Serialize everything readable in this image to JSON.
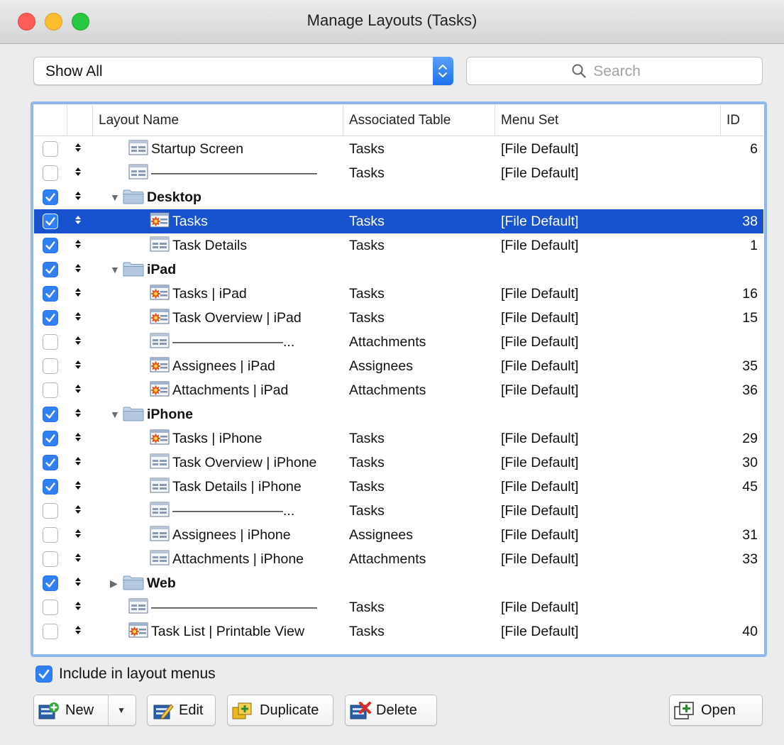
{
  "window": {
    "title": "Manage Layouts (Tasks)"
  },
  "filter": {
    "selected": "Show All"
  },
  "search": {
    "placeholder": "Search",
    "value": ""
  },
  "table": {
    "columns": {
      "name": "Layout Name",
      "table": "Associated Table",
      "menu": "Menu Set",
      "id": "ID"
    },
    "rows": [
      {
        "checked": false,
        "indent": 1,
        "kind": "layout",
        "icon": "list-layout-icon",
        "name": "Startup Screen",
        "table": "Tasks",
        "menu": "[File Default]",
        "id": "6"
      },
      {
        "checked": false,
        "indent": 1,
        "kind": "layout",
        "icon": "list-layout-icon",
        "name": "————————————",
        "table": "Tasks",
        "menu": "[File Default]",
        "id": ""
      },
      {
        "checked": true,
        "indent": 0,
        "kind": "folder",
        "expanded": true,
        "icon": "folder-icon",
        "name": "Desktop",
        "table": "",
        "menu": "",
        "id": ""
      },
      {
        "checked": true,
        "indent": 2,
        "kind": "layout",
        "icon": "starred-layout-icon",
        "name": "Tasks",
        "table": "Tasks",
        "menu": "[File Default]",
        "id": "38",
        "selected": true
      },
      {
        "checked": true,
        "indent": 2,
        "kind": "layout",
        "icon": "list-layout-icon",
        "name": "Task Details",
        "table": "Tasks",
        "menu": "[File Default]",
        "id": "1"
      },
      {
        "checked": true,
        "indent": 0,
        "kind": "folder",
        "expanded": true,
        "icon": "folder-icon",
        "name": "iPad",
        "table": "",
        "menu": "",
        "id": ""
      },
      {
        "checked": true,
        "indent": 2,
        "kind": "layout",
        "icon": "starred-layout-icon",
        "name": "Tasks | iPad",
        "table": "Tasks",
        "menu": "[File Default]",
        "id": "16"
      },
      {
        "checked": true,
        "indent": 2,
        "kind": "layout",
        "icon": "starred-layout-icon",
        "name": "Task Overview | iPad",
        "table": "Tasks",
        "menu": "[File Default]",
        "id": "15"
      },
      {
        "checked": false,
        "indent": 2,
        "kind": "layout",
        "icon": "list-layout-icon",
        "name": "————————...",
        "table": "Attachments",
        "menu": "[File Default]",
        "id": ""
      },
      {
        "checked": false,
        "indent": 2,
        "kind": "layout",
        "icon": "starred-layout-icon",
        "name": "Assignees | iPad",
        "table": "Assignees",
        "menu": "[File Default]",
        "id": "35"
      },
      {
        "checked": false,
        "indent": 2,
        "kind": "layout",
        "icon": "starred-layout-icon",
        "name": "Attachments | iPad",
        "table": "Attachments",
        "menu": "[File Default]",
        "id": "36"
      },
      {
        "checked": true,
        "indent": 0,
        "kind": "folder",
        "expanded": true,
        "icon": "folder-icon",
        "name": "iPhone",
        "table": "",
        "menu": "",
        "id": ""
      },
      {
        "checked": true,
        "indent": 2,
        "kind": "layout",
        "icon": "starred-layout-icon",
        "name": "Tasks | iPhone",
        "table": "Tasks",
        "menu": "[File Default]",
        "id": "29"
      },
      {
        "checked": true,
        "indent": 2,
        "kind": "layout",
        "icon": "list-layout-icon",
        "name": "Task Overview | iPhone",
        "table": "Tasks",
        "menu": "[File Default]",
        "id": "30"
      },
      {
        "checked": true,
        "indent": 2,
        "kind": "layout",
        "icon": "list-layout-icon",
        "name": "Task Details | iPhone",
        "table": "Tasks",
        "menu": "[File Default]",
        "id": "45"
      },
      {
        "checked": false,
        "indent": 2,
        "kind": "layout",
        "icon": "list-layout-icon",
        "name": "————————...",
        "table": "Tasks",
        "menu": "[File Default]",
        "id": ""
      },
      {
        "checked": false,
        "indent": 2,
        "kind": "layout",
        "icon": "list-layout-icon",
        "name": "Assignees | iPhone",
        "table": "Assignees",
        "menu": "[File Default]",
        "id": "31"
      },
      {
        "checked": false,
        "indent": 2,
        "kind": "layout",
        "icon": "list-layout-icon",
        "name": "Attachments | iPhone",
        "table": "Attachments",
        "menu": "[File Default]",
        "id": "33"
      },
      {
        "checked": true,
        "indent": 0,
        "kind": "folder",
        "expanded": false,
        "icon": "folder-icon",
        "name": "Web",
        "table": "",
        "menu": "",
        "id": ""
      },
      {
        "checked": false,
        "indent": 1,
        "kind": "layout",
        "icon": "list-layout-icon",
        "name": "————————————",
        "table": "Tasks",
        "menu": "[File Default]",
        "id": ""
      },
      {
        "checked": false,
        "indent": 1,
        "kind": "layout",
        "icon": "starred-layout-icon",
        "name": "Task List | Printable View",
        "table": "Tasks",
        "menu": "[File Default]",
        "id": "40"
      }
    ]
  },
  "include": {
    "checked": true,
    "label": "Include in layout menus"
  },
  "buttons": {
    "new": {
      "label": "New",
      "icon": "new-layout-icon"
    },
    "edit": {
      "label": "Edit",
      "icon": "edit-layout-icon"
    },
    "duplicate": {
      "label": "Duplicate",
      "icon": "duplicate-layout-icon"
    },
    "delete": {
      "label": "Delete",
      "icon": "delete-layout-icon"
    },
    "open": {
      "label": "Open",
      "icon": "open-layout-icon"
    }
  },
  "colors": {
    "selection": "#1753cf",
    "checkbox_on": "#2f7ff5",
    "focus_ring": "#8fb8ec",
    "popup_accent": "#1e71ec"
  }
}
